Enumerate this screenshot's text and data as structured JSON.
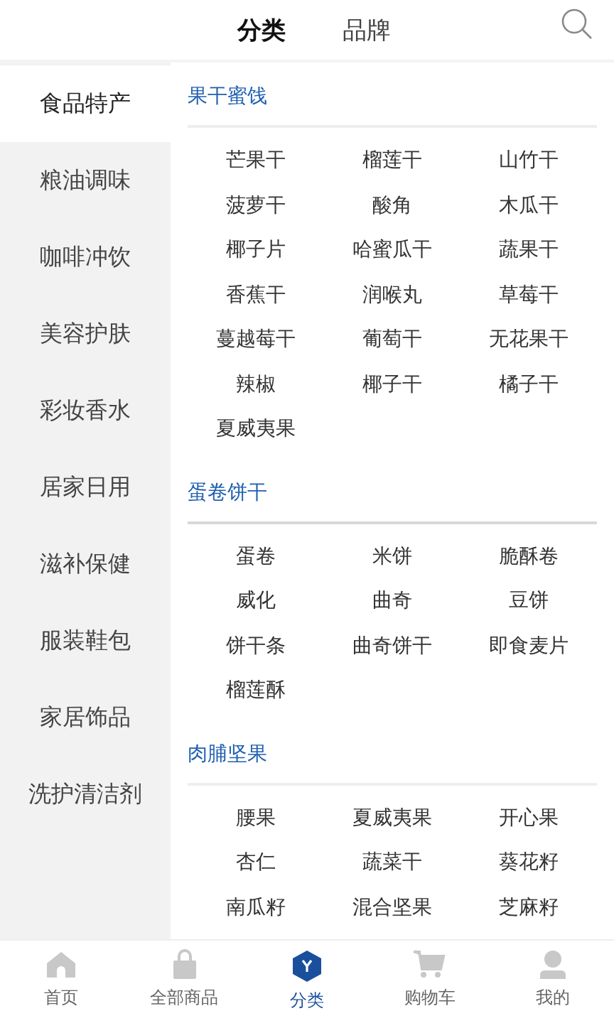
{
  "top_tabs": [
    {
      "label": "分类",
      "selected": true
    },
    {
      "label": "品牌",
      "selected": false
    }
  ],
  "sidebar": {
    "items": [
      {
        "label": "食品特产",
        "selected": true
      },
      {
        "label": "粮油调味",
        "selected": false
      },
      {
        "label": "咖啡冲饮",
        "selected": false
      },
      {
        "label": "美容护肤",
        "selected": false
      },
      {
        "label": "彩妆香水",
        "selected": false
      },
      {
        "label": "居家日用",
        "selected": false
      },
      {
        "label": "滋补保健",
        "selected": false
      },
      {
        "label": "服装鞋包",
        "selected": false
      },
      {
        "label": "家居饰品",
        "selected": false
      },
      {
        "label": "洗护清洁剂",
        "selected": false
      }
    ]
  },
  "sections": [
    {
      "title": "果干蜜饯",
      "items": [
        "芒果干",
        "榴莲干",
        "山竹干",
        "菠萝干",
        "酸角",
        "木瓜干",
        "椰子片",
        "哈蜜瓜干",
        "蔬果干",
        "香蕉干",
        "润喉丸",
        "草莓干",
        "蔓越莓干",
        "葡萄干",
        "无花果干",
        "辣椒",
        "椰子干",
        "橘子干",
        "夏威夷果"
      ]
    },
    {
      "title": "蛋卷饼干",
      "items": [
        "蛋卷",
        "米饼",
        "脆酥卷",
        "威化",
        "曲奇",
        "豆饼",
        "饼干条",
        "曲奇饼干",
        "即食麦片",
        "榴莲酥"
      ]
    },
    {
      "title": "肉脯坚果",
      "items": [
        "腰果",
        "夏威夷果",
        "开心果",
        "杏仁",
        "蔬菜干",
        "葵花籽",
        "南瓜籽",
        "混合坚果",
        "芝麻籽"
      ]
    }
  ],
  "tab_bar": [
    {
      "kind": "home",
      "label": "首页",
      "selected": false
    },
    {
      "kind": "bag",
      "label": "全部商品",
      "selected": false
    },
    {
      "kind": "category",
      "label": "分类",
      "selected": true
    },
    {
      "kind": "cart",
      "label": "购物车",
      "selected": false
    },
    {
      "kind": "user",
      "label": "我的",
      "selected": false
    }
  ]
}
